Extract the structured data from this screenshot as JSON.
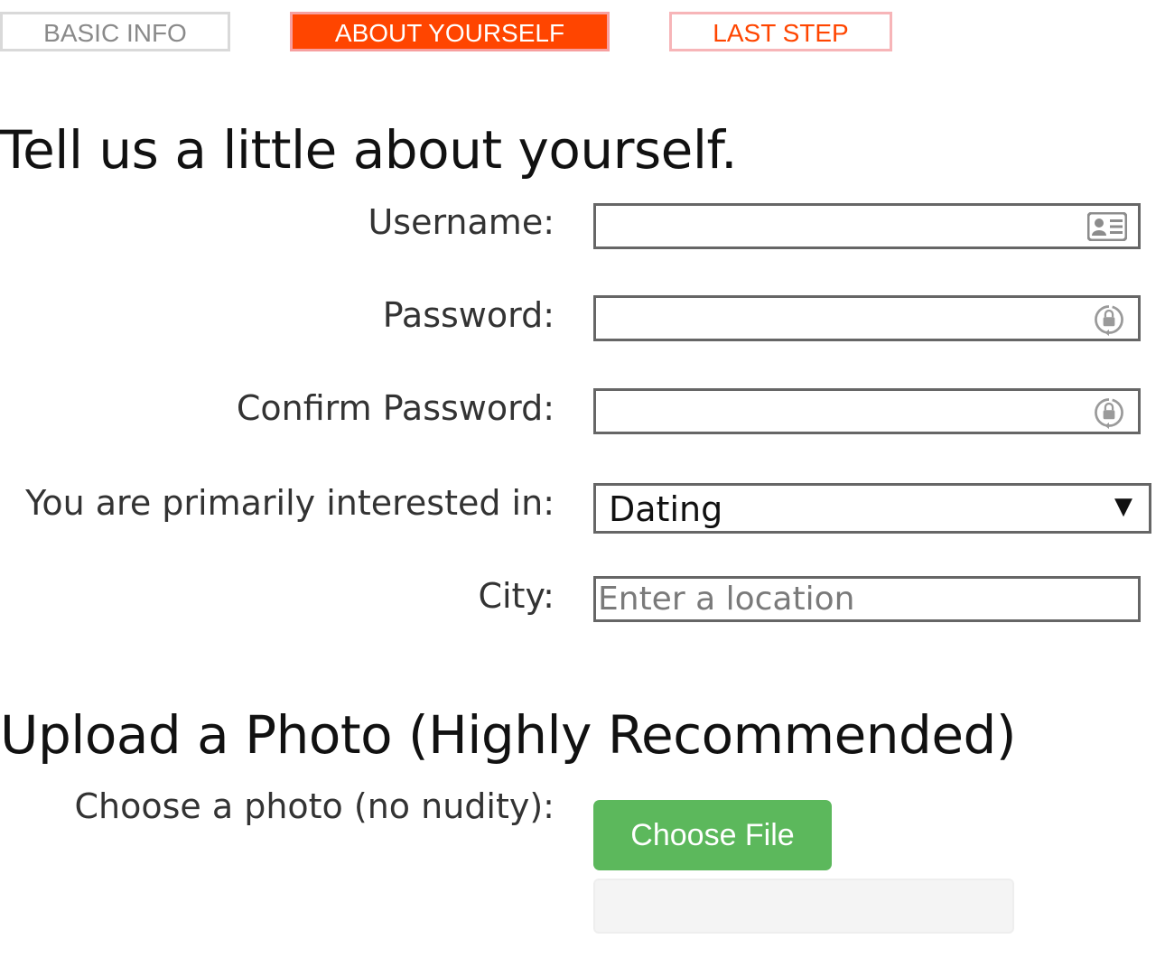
{
  "steps": {
    "basic_info": "BASIC INFO",
    "about_yourself": "ABOUT YOURSELF",
    "last_step": "LAST STEP"
  },
  "about_section": {
    "heading": "Tell us a little about yourself.",
    "username_label": "Username:",
    "username_value": "",
    "password_label": "Password:",
    "password_value": "",
    "confirm_password_label": "Confirm Password:",
    "confirm_password_value": "",
    "interest_label": "You are primarily interested in:",
    "interest_selected": "Dating",
    "city_label": "City:",
    "city_placeholder": "Enter a location"
  },
  "photo_section": {
    "heading": "Upload a Photo (Highly Recommended)",
    "photo_label": "Choose a photo (no nudity):",
    "choose_file_label": "Choose File"
  },
  "colors": {
    "accent": "#ff4500",
    "upload_button": "#5cb85c",
    "field_border": "#666666"
  },
  "icons": {
    "username_field": "contact-card-icon",
    "password_field": "lock-refresh-icon",
    "confirm_password_field": "lock-refresh-icon",
    "select_arrow": "triangle-down-icon"
  }
}
